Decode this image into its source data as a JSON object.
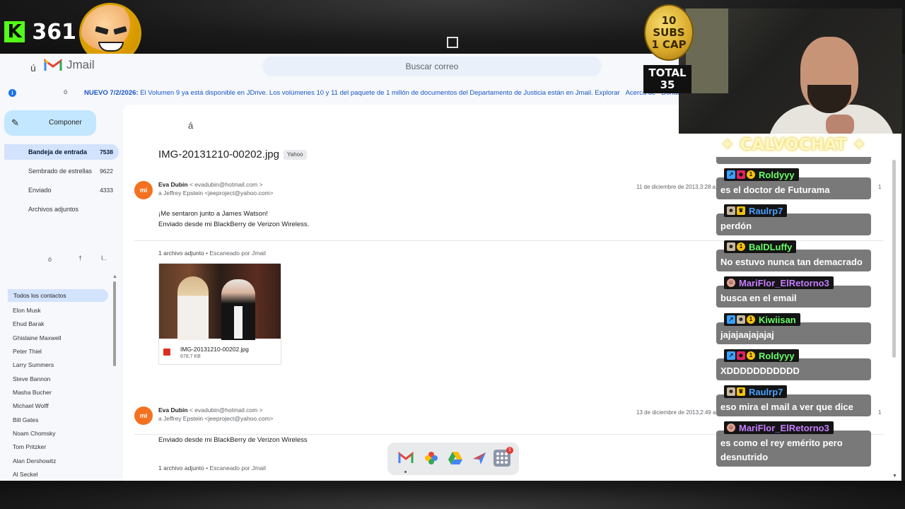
{
  "stream": {
    "kick_icon": "K",
    "viewer_count": "361",
    "subs_coin_text": [
      "10 SUBS",
      "1 CAP"
    ],
    "total_label": "TOTAL",
    "total_value": "35"
  },
  "app": {
    "menu_glyph": "ú",
    "name": "Jmail",
    "search_placeholder": "Buscar correo"
  },
  "banner": {
    "glyph": "ó",
    "date": "NUEVO 7/2/2026:",
    "text_part1": "El Volumen 9 ya está disponible en ",
    "jdrive": "JDrive",
    "text_part2": ". Los volúmenes 10 y 11 del paquete de 1 millón de documentos del Departamento de Justicia están en Jmail. ",
    "explore": "Explorar",
    "about": "Acerca de",
    "donate": "Donar"
  },
  "sidebar": {
    "compose": "Componer",
    "nav": [
      {
        "label": "Bandeja de entrada",
        "count": "7538"
      },
      {
        "label": "Sembrado de estrellas",
        "count": "9622"
      },
      {
        "label": "Enviado",
        "count": "4333"
      },
      {
        "label": "Archivos adjuntos",
        "count": ""
      }
    ],
    "tools": [
      "ó",
      "†",
      "I.."
    ],
    "contacts_header": "Todos los contactos",
    "contacts": [
      "Elon Musk",
      "Ehud Barak",
      "Ghislaine Maxwell",
      "Peter Thiel",
      "Larry Summers",
      "Steve Bannon",
      "Masha Bucher",
      "Michael Wolff",
      "Bill Gates",
      "Noam Chomsky",
      "Tom Pritzker",
      "Alan Dershowitz",
      "Al Seckel"
    ]
  },
  "email": {
    "back_glyph": "á",
    "subject": "IMG-20131210-00202.jpg",
    "label": "Yahoo",
    "messages": [
      {
        "avatar": "mi",
        "sender_name": "Eva Dubin",
        "sender_addr": "< evadubin@hotmail.com >",
        "recipient": "a Jeffrey Epstein <jeeproject@yahoo.com>",
        "date": "11 de diciembre de 2013,3:28 a.",
        "index": "1",
        "body": [
          "¡Me sentaron junto a James Watson!",
          "Enviado desde mi BlackBerry de Verizon Wireless."
        ],
        "attach_count": "1 archivo adjunto",
        "scanned": "• Escaneado por Jmail",
        "file_name": "IMG-20131210-00202.jpg",
        "file_size": "678,7 KB"
      },
      {
        "avatar": "mi",
        "sender_name": "Eva Dubin",
        "sender_addr": "< evadubin@hotmail.com >",
        "recipient": "a Jeffrey Epstein <jeeproject@yahoo.com>",
        "date": "13 de diciembre de 2013,2:49 a.",
        "index": "1",
        "body": [
          "Enviado desde mi BlackBerry de Verizon Wireless"
        ],
        "attach_count": "1 archivo adjunto",
        "scanned": "• Escaneado por Jmail"
      }
    ]
  },
  "dock": {
    "apps": [
      "gmail-app",
      "photos-app",
      "drive-app",
      "flights-app",
      "app-grid"
    ],
    "notification_count": "1"
  },
  "chat": {
    "title": "✦ CALVOCHAT ✦",
    "messages": [
      {
        "user": "Roldyyy",
        "color": "#66ff66",
        "text": "es el doctor de Futurama"
      },
      {
        "user": "Raulrp7",
        "color": "#4aa0ff",
        "text": "perdón"
      },
      {
        "user": "BalDLuffy",
        "color": "#66ff66",
        "text": "No estuvo nunca tan demacrado"
      },
      {
        "user": "MariFlor_ElRetorno3",
        "color": "#c77dff",
        "text": "busca en el email"
      },
      {
        "user": "Kiwiisan",
        "color": "#66ff66",
        "text": "jajajaajajajaj"
      },
      {
        "user": "Roldyyy",
        "color": "#66ff66",
        "text": "XDDDDDDDDDDD"
      },
      {
        "user": "Raulrp7",
        "color": "#4aa0ff",
        "text": "eso mira el mail a ver que dice"
      },
      {
        "user": "MariFlor_ElRetorno3",
        "color": "#c77dff",
        "text": "es como el rey emérito pero desnutrido"
      }
    ]
  }
}
